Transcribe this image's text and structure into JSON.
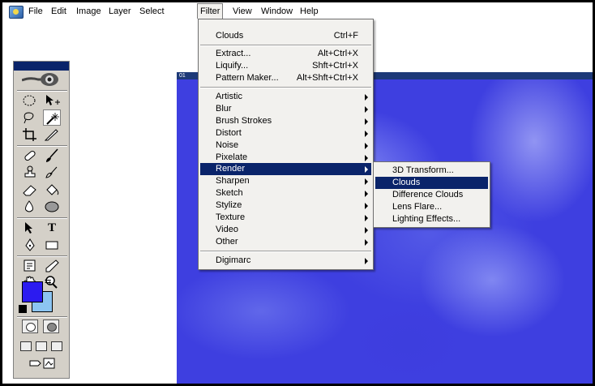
{
  "menubar": {
    "items": [
      "File",
      "Edit",
      "Image",
      "Layer",
      "Select",
      "Filter",
      "View",
      "Window",
      "Help"
    ],
    "active": "Filter"
  },
  "document": {
    "title": "01"
  },
  "filter_menu": {
    "last_filter": {
      "label": "Clouds",
      "shortcut": "Ctrl+F"
    },
    "extract": {
      "label": "Extract...",
      "shortcut": "Alt+Ctrl+X"
    },
    "liquify": {
      "label": "Liquify...",
      "shortcut": "Shft+Ctrl+X"
    },
    "pattern_maker": {
      "label": "Pattern Maker...",
      "shortcut": "Alt+Shft+Ctrl+X"
    },
    "groups": [
      "Artistic",
      "Blur",
      "Brush Strokes",
      "Distort",
      "Noise",
      "Pixelate",
      "Render",
      "Sharpen",
      "Sketch",
      "Stylize",
      "Texture",
      "Video",
      "Other"
    ],
    "highlighted_group": "Render",
    "digimarc": "Digimarc"
  },
  "render_submenu": {
    "items": [
      "3D Transform...",
      "Clouds",
      "Difference Clouds",
      "Lens Flare...",
      "Lighting Effects..."
    ],
    "highlighted": "Clouds"
  },
  "colors": {
    "foreground": "#2c1bf0",
    "background": "#8cc4f2",
    "menu_highlight": "#0a246a",
    "canvas_base": "#3e3fe0"
  },
  "toolbox": {
    "tools": [
      "marquee-tool",
      "move-tool",
      "lasso-tool",
      "magic-wand-tool",
      "crop-tool",
      "slice-tool",
      "healing-brush-tool",
      "brush-tool",
      "clone-stamp-tool",
      "history-brush-tool",
      "eraser-tool",
      "paint-bucket-tool",
      "blur-tool",
      "dodge-tool",
      "path-selection-tool",
      "type-tool",
      "pen-tool",
      "rectangle-tool",
      "notes-tool",
      "eyedropper-tool",
      "hand-tool",
      "zoom-tool"
    ],
    "selected_tool": "magic-wand-tool",
    "type_tool_glyph": "T"
  }
}
